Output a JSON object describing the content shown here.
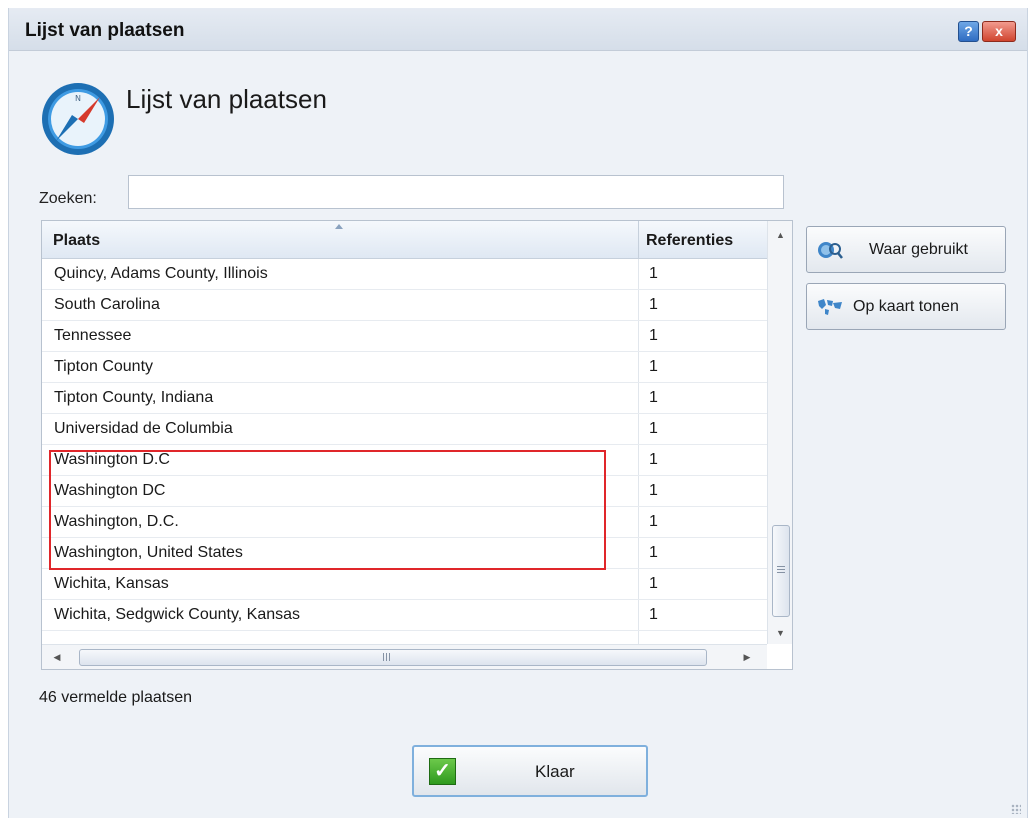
{
  "window": {
    "title": "Lijst van plaatsen",
    "help_label": "?",
    "close_label": "x"
  },
  "header": {
    "icon": "compass-icon",
    "title": "Lijst van plaatsen"
  },
  "search": {
    "label": "Zoeken:",
    "value": "",
    "placeholder": ""
  },
  "table": {
    "columns": [
      "Plaats",
      "Referenties"
    ],
    "sorted_column": "Plaats",
    "rows": [
      {
        "place": "Quincy, Adams County, Illinois",
        "refs": "1"
      },
      {
        "place": "South Carolina",
        "refs": "1"
      },
      {
        "place": "Tennessee",
        "refs": "1"
      },
      {
        "place": "Tipton County",
        "refs": "1"
      },
      {
        "place": "Tipton County, Indiana",
        "refs": "1"
      },
      {
        "place": "Universidad de Columbia",
        "refs": "1"
      },
      {
        "place": "Washington D.C",
        "refs": "1"
      },
      {
        "place": "Washington DC",
        "refs": "1"
      },
      {
        "place": "Washington, D.C.",
        "refs": "1"
      },
      {
        "place": "Washington, United States",
        "refs": "1"
      },
      {
        "place": "Wichita, Kansas",
        "refs": "1"
      },
      {
        "place": "Wichita, Sedgwick County, Kansas",
        "refs": "1"
      }
    ]
  },
  "actions": {
    "where_used": {
      "label": "Waar gebruikt",
      "icon": "where-used-icon"
    },
    "show_on_map": {
      "label": "Op kaart tonen",
      "icon": "map-icon"
    }
  },
  "status": "46 vermelde plaatsen",
  "footer": {
    "done_label": "Klaar",
    "done_icon": "checkmark-icon"
  },
  "colors": {
    "highlight": "#e0262a",
    "accent": "#7fb0dd"
  }
}
